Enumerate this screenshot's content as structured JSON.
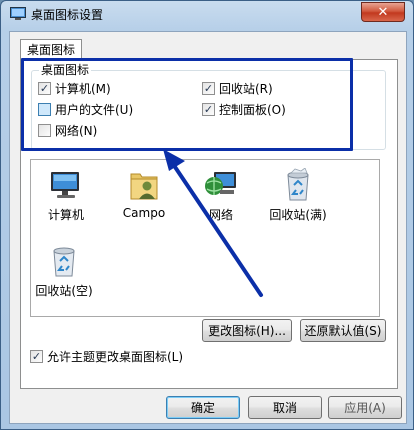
{
  "window": {
    "title": "桌面图标设置",
    "close_label": "✕"
  },
  "tab": {
    "label": "桌面图标"
  },
  "group": {
    "label": "桌面图标",
    "checkboxes": [
      {
        "label": "计算机(M)",
        "checked": true
      },
      {
        "label": "回收站(R)",
        "checked": true
      },
      {
        "label": "用户的文件(U)",
        "checked": false
      },
      {
        "label": "控制面板(O)",
        "checked": true
      },
      {
        "label": "网络(N)",
        "checked": false
      }
    ]
  },
  "icons": [
    {
      "name": "computer-icon",
      "label": "计算机"
    },
    {
      "name": "user-folder-icon",
      "label": "Campo"
    },
    {
      "name": "network-icon",
      "label": "网络"
    },
    {
      "name": "recycle-bin-full-icon",
      "label": "回收站(满)"
    },
    {
      "name": "recycle-bin-empty-icon",
      "label": "回收站(空)"
    }
  ],
  "buttons": {
    "change_icon": "更改图标(H)...",
    "restore_default": "还原默认值(S)",
    "ok": "确定",
    "cancel": "取消",
    "apply": "应用(A)"
  },
  "theme_option": {
    "label": "允许主题更改桌面图标(L)",
    "checked": true
  },
  "annotation": {
    "highlight_color": "#0b2fa8"
  }
}
